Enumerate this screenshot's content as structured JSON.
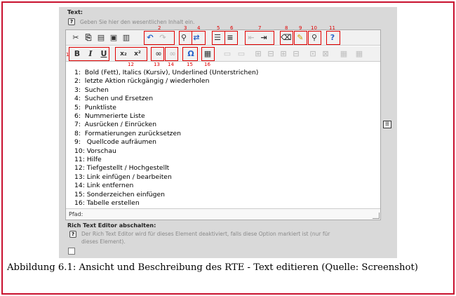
{
  "text_section": {
    "label": "Text:",
    "hint": "Geben Sie hier den wesentlichen Inhalt ein."
  },
  "toolbar": {
    "row1": [
      {
        "name": "cut-icon",
        "glyph": "✂"
      },
      {
        "name": "copy-icon",
        "glyph": "⎘"
      },
      {
        "name": "paste-icon",
        "glyph": "📋"
      },
      {
        "name": "paste-text-icon",
        "glyph": "▣"
      },
      {
        "name": "paste-word-icon",
        "glyph": "▤"
      },
      {
        "name": "undo-icon",
        "glyph": "↶"
      },
      {
        "name": "redo-icon",
        "glyph": "↷"
      },
      {
        "name": "find-icon",
        "glyph": "⚲"
      },
      {
        "name": "replace-icon",
        "glyph": "⇄"
      },
      {
        "name": "bullet-list-icon",
        "glyph": "☰"
      },
      {
        "name": "numbered-list-icon",
        "glyph": "≡"
      },
      {
        "name": "outdent-icon",
        "glyph": "⇤"
      },
      {
        "name": "indent-icon",
        "glyph": "⇥"
      },
      {
        "name": "remove-format-icon",
        "glyph": "⌫"
      },
      {
        "name": "cleanup-icon",
        "glyph": "✎"
      },
      {
        "name": "preview-icon",
        "glyph": "🔍"
      },
      {
        "name": "help-icon",
        "glyph": "?"
      }
    ],
    "row2": [
      {
        "name": "bold-icon",
        "glyph": "B"
      },
      {
        "name": "italic-icon",
        "glyph": "I"
      },
      {
        "name": "underline-icon",
        "glyph": "U"
      },
      {
        "name": "subscript-icon",
        "glyph": "x₂"
      },
      {
        "name": "superscript-icon",
        "glyph": "x²"
      },
      {
        "name": "link-icon",
        "glyph": "∞"
      },
      {
        "name": "unlink-icon",
        "glyph": "⊘"
      },
      {
        "name": "special-char-icon",
        "glyph": "Ω"
      },
      {
        "name": "table-icon",
        "glyph": "▦"
      },
      {
        "name": "table-props-icon",
        "glyph": "▭"
      },
      {
        "name": "table-cell-icon",
        "glyph": "▭"
      },
      {
        "name": "insert-row-icon",
        "glyph": "⊞"
      },
      {
        "name": "delete-row-icon",
        "glyph": "⊟"
      },
      {
        "name": "insert-col-icon",
        "glyph": "⊞"
      },
      {
        "name": "delete-col-icon",
        "glyph": "⊟"
      },
      {
        "name": "split-cells-icon",
        "glyph": "⊡"
      },
      {
        "name": "merge-cells-icon",
        "glyph": "⊠"
      },
      {
        "name": "table-grid-icon",
        "glyph": "▦"
      },
      {
        "name": "table-grid2-icon",
        "glyph": "▦"
      }
    ]
  },
  "markers": [
    "1",
    "2",
    "3",
    "4",
    "5",
    "6",
    "7",
    "8",
    "9",
    "10",
    "11",
    "12",
    "13",
    "14",
    "15",
    "16"
  ],
  "content_lines": [
    "1:  Bold (Fett), Italics (Kursiv), Underlined (Unterstrichen)",
    "2:  letzte Aktion rückgängig / wiederholen",
    "3:  Suchen",
    "4:  Suchen und Ersetzen",
    "5:  Punktliste",
    "6:  Nummerierte Liste",
    "7:  Ausrücken / Einrücken",
    "8:  Formatierungen zurücksetzen",
    "9:   Quellcode aufräumen",
    "10: Vorschau",
    "11: Hilfe",
    "12: Tiefgestellt / Hochgestellt",
    "13: Link einfügen / bearbeiten",
    "14: Link entfernen",
    "15: Sonderzeichen einfügen",
    "16: Tabelle erstellen"
  ],
  "path_label": "Pfad:",
  "rte_section": {
    "label": "Rich Text Editor abschalten:",
    "hint_line1": "Der Rich Text Editor wird für dieses Element deaktiviert, falls diese Option markiert ist (nur für",
    "hint_line2": "dieses Element)."
  },
  "caption": "Abbildung 6.1: Ansicht und Beschreibung des RTE - Text editieren (Quelle: Screenshot)",
  "colors": {
    "marker": "#e10000",
    "frame": "#c8102e",
    "panel": "#d9d9d9"
  }
}
